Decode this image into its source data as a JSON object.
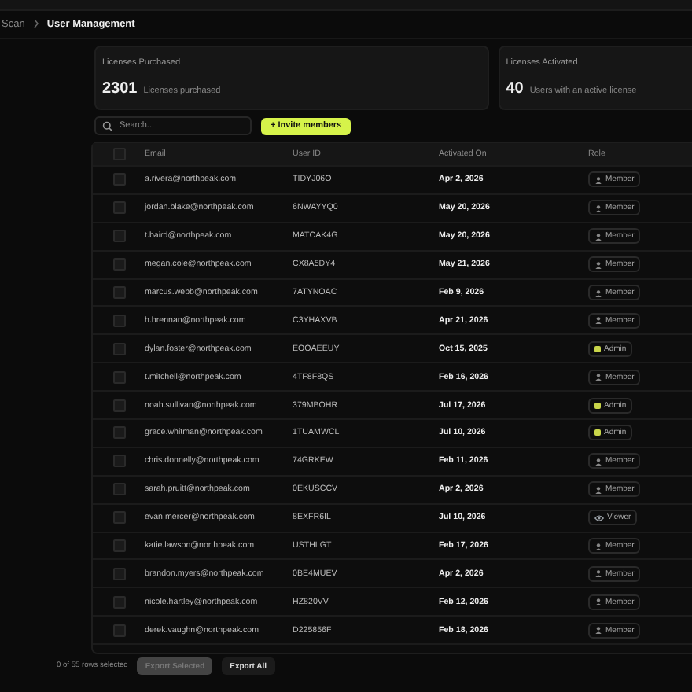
{
  "breadcrumb": [
    {
      "label": "Scan",
      "selected": false
    },
    {
      "label": "User Management",
      "selected": true
    }
  ],
  "stats": [
    {
      "title": "Licenses Purchased",
      "value": "2301",
      "caption": "Licenses purchased"
    },
    {
      "title": "Licenses Activated",
      "value": "40",
      "caption": "Users with an active license"
    }
  ],
  "search": {
    "placeholder": "Search..."
  },
  "invite_button": {
    "icon": "+",
    "label": "Invite members"
  },
  "table": {
    "select_all": {
      "checked": false
    },
    "columns": [
      "Email",
      "User ID",
      "Activated On",
      "Role"
    ],
    "rows": [
      {
        "checked": false,
        "email": "a.rivera@northpeak.com",
        "user_id": "TIDYJ06O",
        "activated": "Apr 2, 2026",
        "role": "Member",
        "kind": "member"
      },
      {
        "checked": false,
        "email": "jordan.blake@northpeak.com",
        "user_id": "6NWAYYQ0",
        "activated": "May 20, 2026",
        "role": "Member",
        "kind": "member"
      },
      {
        "checked": false,
        "email": "t.baird@northpeak.com",
        "user_id": "MATCAK4G",
        "activated": "May 20, 2026",
        "role": "Member",
        "kind": "member"
      },
      {
        "checked": false,
        "email": "megan.cole@northpeak.com",
        "user_id": "CX8A5DY4",
        "activated": "May 21, 2026",
        "role": "Member",
        "kind": "member"
      },
      {
        "checked": false,
        "email": "marcus.webb@northpeak.com",
        "user_id": "7ATYNOAC",
        "activated": "Feb 9, 2026",
        "role": "Member",
        "kind": "member"
      },
      {
        "checked": false,
        "email": "h.brennan@northpeak.com",
        "user_id": "C3YHAXVB",
        "activated": "Apr 21, 2026",
        "role": "Member",
        "kind": "member"
      },
      {
        "checked": false,
        "email": "dylan.foster@northpeak.com",
        "user_id": "EOOAEEUY",
        "activated": "Oct 15, 2025",
        "role": "Admin",
        "kind": "admin"
      },
      {
        "checked": false,
        "email": "t.mitchell@northpeak.com",
        "user_id": "4TF8F8QS",
        "activated": "Feb 16, 2026",
        "role": "Member",
        "kind": "member"
      },
      {
        "checked": false,
        "email": "noah.sullivan@northpeak.com",
        "user_id": "379MBOHR",
        "activated": "Jul 17, 2026",
        "role": "Admin",
        "kind": "admin"
      },
      {
        "checked": false,
        "email": "grace.whitman@northpeak.com",
        "user_id": "1TUAMWCL",
        "activated": "Jul 10, 2026",
        "role": "Admin",
        "kind": "admin"
      },
      {
        "checked": false,
        "email": "chris.donnelly@northpeak.com",
        "user_id": "74GRKEW",
        "activated": "Feb 11, 2026",
        "role": "Member",
        "kind": "member"
      },
      {
        "checked": false,
        "email": "sarah.pruitt@northpeak.com",
        "user_id": "0EKUSCCV",
        "activated": "Apr 2, 2026",
        "role": "Member",
        "kind": "member"
      },
      {
        "checked": false,
        "email": "evan.mercer@northpeak.com",
        "user_id": "8EXFR6IL",
        "activated": "Jul 10, 2026",
        "role": "Viewer",
        "kind": "viewer"
      },
      {
        "checked": false,
        "email": "katie.lawson@northpeak.com",
        "user_id": "USTHLGT",
        "activated": "Feb 17, 2026",
        "role": "Member",
        "kind": "member"
      },
      {
        "checked": false,
        "email": "brandon.myers@northpeak.com",
        "user_id": "0BE4MUEV",
        "activated": "Apr 2, 2026",
        "role": "Member",
        "kind": "member"
      },
      {
        "checked": false,
        "email": "nicole.hartley@northpeak.com",
        "user_id": "HZ820VV",
        "activated": "Feb 12, 2026",
        "role": "Member",
        "kind": "member"
      },
      {
        "checked": false,
        "email": "derek.vaughn@northpeak.com",
        "user_id": "D225856F",
        "activated": "Feb 18, 2026",
        "role": "Member",
        "kind": "member"
      }
    ]
  },
  "footer": {
    "selection": "0 of 55 rows selected",
    "buttons": [
      {
        "label": "Export Selected",
        "disabled": true
      },
      {
        "label": "Export All",
        "disabled": false
      }
    ]
  }
}
